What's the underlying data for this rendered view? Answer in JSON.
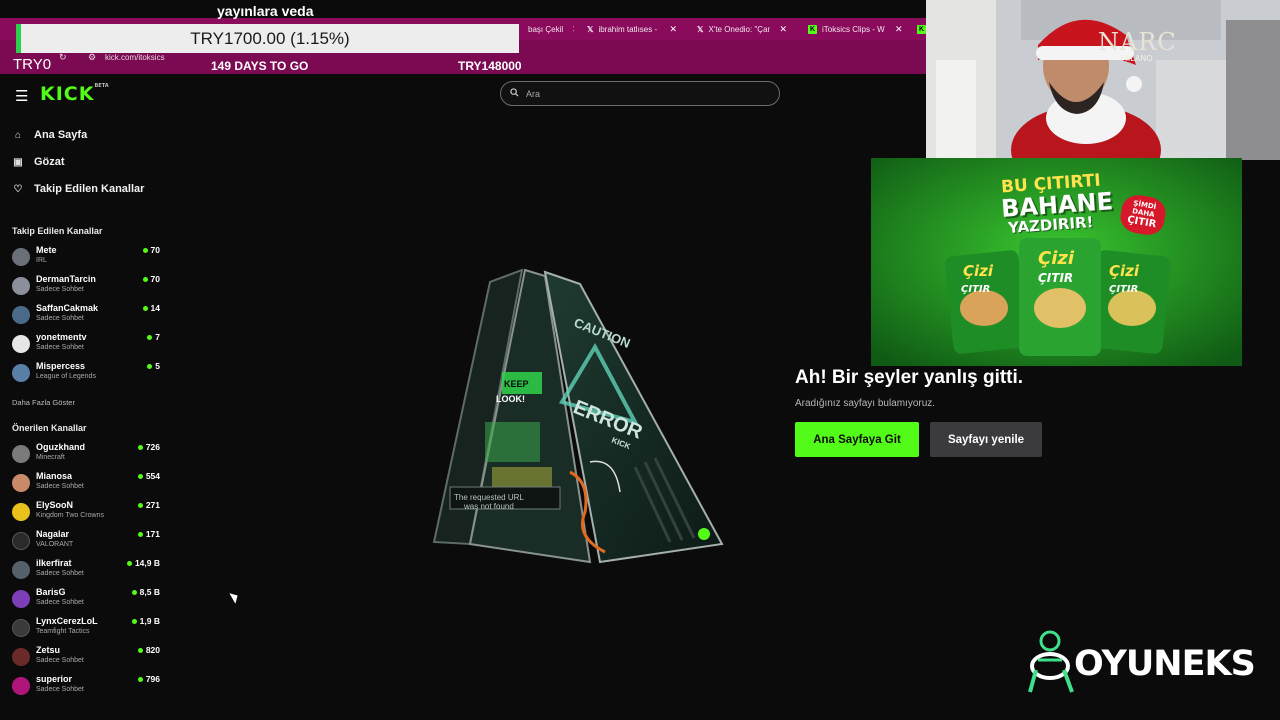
{
  "stream_overlay": {
    "top_caption": "yayınlara veda",
    "price_ticker": "TRY1700.00 (1.15%)",
    "left_value": "TRY0",
    "countdown": "149 DAYS TO GO",
    "goal_value": "TRY148000",
    "webcam_tag": "NARC",
    "webcam_tag_sub": "MILANO",
    "brand": "OYUNEKS"
  },
  "browser": {
    "tabs": [
      {
        "label": "başı Çekil",
        "icon": "page-icon"
      },
      {
        "label": "ibrahim tatlıses - ",
        "icon": "x-icon"
      },
      {
        "label": "X'te Onedio: \"Çan",
        "icon": "x-icon"
      },
      {
        "label": "iToksics Clips - W",
        "icon": "kick-icon"
      }
    ],
    "url": "kick.com/itoksics"
  },
  "kick": {
    "logo": "KICK",
    "logo_badge": "BETA",
    "search_placeholder": "Ara",
    "nav": [
      {
        "label": "Ana Sayfa",
        "icon": "home-icon"
      },
      {
        "label": "Gözat",
        "icon": "browse-icon"
      },
      {
        "label": "Takip Edilen Kanallar",
        "icon": "heart-icon"
      }
    ],
    "followed_heading": "Takip Edilen Kanallar",
    "followed": [
      {
        "name": "Mete",
        "category": "IRL",
        "viewers": "70",
        "color": "#6b6f78"
      },
      {
        "name": "DermanTarcin",
        "category": "Sadece Sohbet",
        "viewers": "70",
        "color": "#8a8f99"
      },
      {
        "name": "SaffanCakmak",
        "category": "Sadece Sohbet",
        "viewers": "14",
        "color": "#4b6a8a"
      },
      {
        "name": "yonetmentv",
        "category": "Sadece Sohbet",
        "viewers": "7",
        "color": "#e6e6e6"
      },
      {
        "name": "Mispercess",
        "category": "League of Legends",
        "viewers": "5",
        "color": "#5a7fa6"
      }
    ],
    "show_more": "Daha Fazla Göster",
    "recommended_heading": "Önerilen Kanallar",
    "recommended": [
      {
        "name": "Oguzkhand",
        "category": "Minecraft",
        "viewers": "726",
        "color": "#7a7a7a"
      },
      {
        "name": "Mianosa",
        "category": "Sadece Sohbet",
        "viewers": "554",
        "color": "#c98a6a"
      },
      {
        "name": "ElySooN",
        "category": "Kingdom Two Crowns",
        "viewers": "271",
        "color": "#e8c21a"
      },
      {
        "name": "Nagalar",
        "category": "VALORANT",
        "viewers": "171",
        "color": "#2a2a2a"
      },
      {
        "name": "ilkerfirat",
        "category": "Sadece Sohbet",
        "viewers": "14,9 B",
        "color": "#55606a"
      },
      {
        "name": "BarisG",
        "category": "Sadece Sohbet",
        "viewers": "8,5 B",
        "color": "#7d3fb8"
      },
      {
        "name": "LynxCerezLoL",
        "category": "Teamfight Tactics",
        "viewers": "1,9 B",
        "color": "#3a3a3a"
      },
      {
        "name": "Zetsu",
        "category": "Sadece Sohbet",
        "viewers": "820",
        "color": "#6a2a2a"
      },
      {
        "name": "superior",
        "category": "Sadece Sohbet",
        "viewers": "796",
        "color": "#b0157a"
      }
    ],
    "error": {
      "title": "Ah! Bir şeyler yanlış gitti.",
      "subtitle": "Aradığınız sayfayı bulamıyoruz.",
      "home_button": "Ana Sayfaya Git",
      "reload_button": "Sayfayı yenile",
      "sign_text": "CAUTION",
      "sign_error": "ERROR",
      "sign_brand": "KICK",
      "sign_footer1": "The requested URL",
      "sign_footer2": "was not found",
      "sign_keep": "KEEP",
      "sign_look": "LOOK!"
    },
    "accent": "#53fc18"
  },
  "ad": {
    "line1": "BU ÇITIRTI",
    "line2": "BAHANE",
    "line3": "YAZDIRIR!",
    "badge_top": "ŞİMDİ",
    "badge_mid": "DAHA",
    "badge_bottom": "ÇITIR",
    "product": "Çizi",
    "product_sub": "ÇITIR"
  }
}
